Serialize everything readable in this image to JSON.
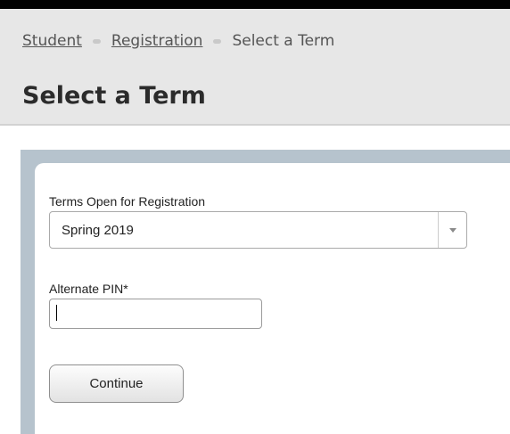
{
  "breadcrumb": {
    "items": [
      "Student",
      "Registration",
      "Select a Term"
    ]
  },
  "page": {
    "title": "Select a Term"
  },
  "form": {
    "term_label": "Terms Open for Registration",
    "term_selected": "Spring 2019",
    "pin_label": "Alternate PIN*",
    "pin_value": "",
    "continue_label": "Continue"
  },
  "icons": {
    "dropdown": "triangle-down-icon"
  },
  "colors": {
    "header_bg": "#e7e7e7",
    "panel_border": "#b6c3cd",
    "top_bar": "#000000"
  }
}
